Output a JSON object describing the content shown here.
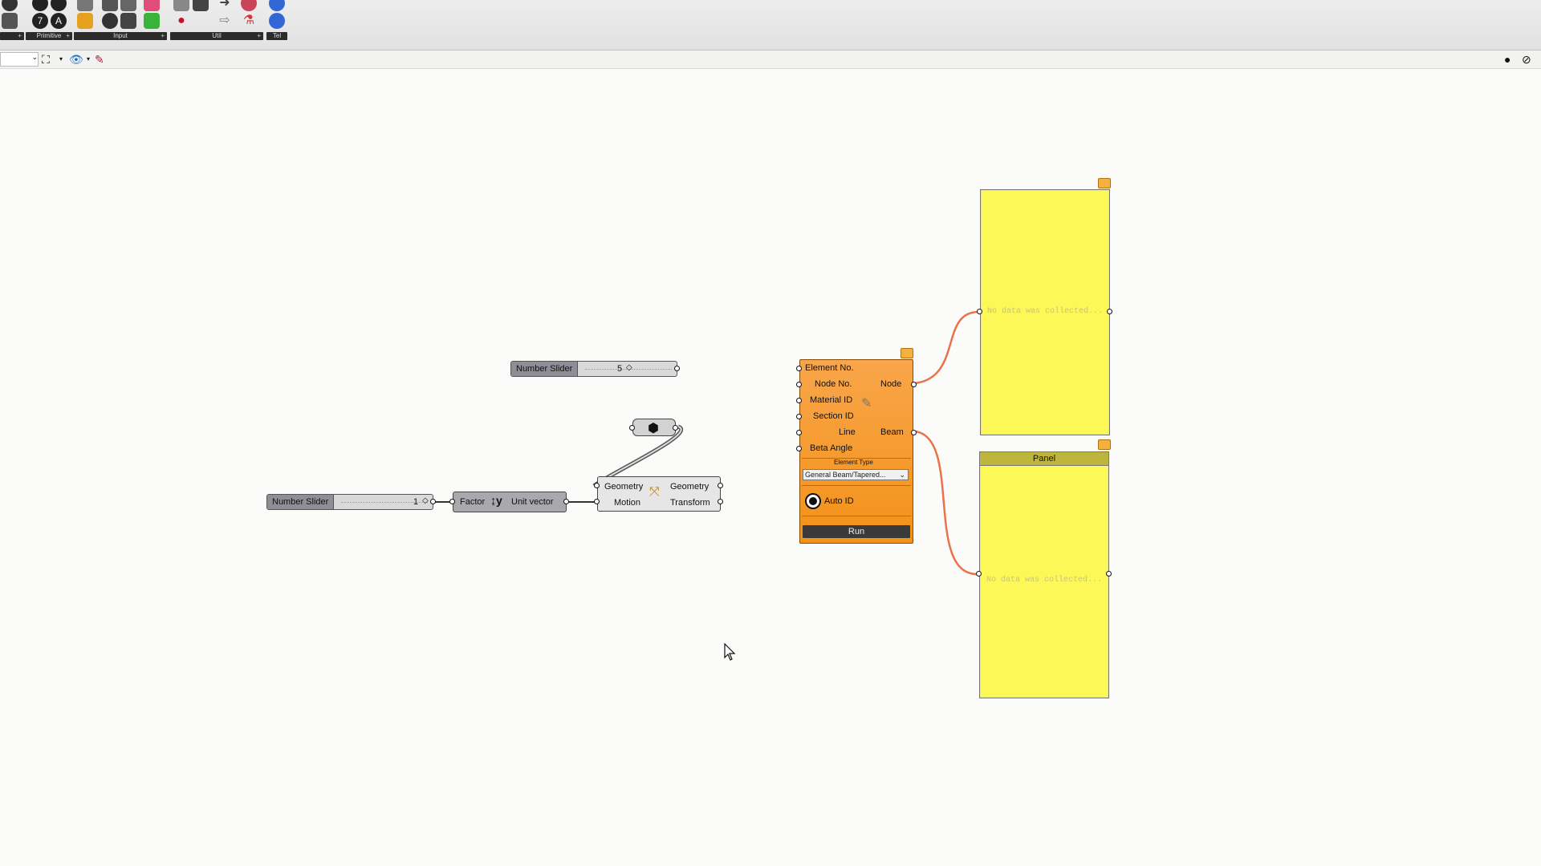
{
  "ribbon": {
    "groups": [
      {
        "label": "Primitive"
      },
      {
        "label": "Input"
      },
      {
        "label": "Util"
      },
      {
        "label": "Tel"
      }
    ]
  },
  "toolbar": {
    "zoom_value": ""
  },
  "canvas": {
    "slider_top": {
      "label": "Number Slider",
      "value": "5"
    },
    "slider_bottom": {
      "label": "Number Slider",
      "value": "1"
    },
    "unit_vector": {
      "input": "Factor",
      "output": "Unit vector",
      "icon": "unit-vector-icon"
    },
    "move": {
      "inputs": [
        "Geometry",
        "Motion"
      ],
      "outputs": [
        "Geometry",
        "Transform"
      ],
      "icon": "move-icon"
    },
    "element_component": {
      "inputs": [
        "Element No.",
        "Node No.",
        "Material ID",
        "Section ID",
        "Line",
        "Beta Angle"
      ],
      "outputs": [
        "Node",
        "Beam"
      ],
      "element_type_label": "Element Type",
      "element_type_value": "General Beam/Tapered...",
      "auto_id_label": "Auto ID",
      "run_label": "Run"
    },
    "panel_top": {
      "message": "No data was collected..."
    },
    "panel_bottom": {
      "title": "Panel",
      "message": "No data was collected..."
    }
  },
  "colors": {
    "wire": "#e8734a",
    "panel_fill": "#fcf857",
    "component_orange": "#f59a2a"
  }
}
